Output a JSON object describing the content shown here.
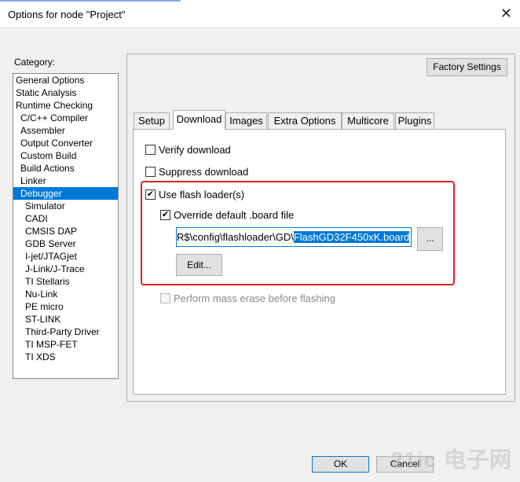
{
  "window": {
    "title": "Options for node \"Project\"",
    "close": "✕"
  },
  "category": {
    "label": "Category:",
    "items": [
      {
        "label": "General Options",
        "level": 0
      },
      {
        "label": "Static Analysis",
        "level": 0
      },
      {
        "label": "Runtime Checking",
        "level": 0
      },
      {
        "label": "C/C++ Compiler",
        "level": 1
      },
      {
        "label": "Assembler",
        "level": 1
      },
      {
        "label": "Output Converter",
        "level": 1
      },
      {
        "label": "Custom Build",
        "level": 1
      },
      {
        "label": "Build Actions",
        "level": 1
      },
      {
        "label": "Linker",
        "level": 1
      },
      {
        "label": "Debugger",
        "level": 1,
        "selected": true
      },
      {
        "label": "Simulator",
        "level": 2
      },
      {
        "label": "CADI",
        "level": 2
      },
      {
        "label": "CMSIS DAP",
        "level": 2
      },
      {
        "label": "GDB Server",
        "level": 2
      },
      {
        "label": "I-jet/JTAGjet",
        "level": 2
      },
      {
        "label": "J-Link/J-Trace",
        "level": 2
      },
      {
        "label": "TI Stellaris",
        "level": 2
      },
      {
        "label": "Nu-Link",
        "level": 2
      },
      {
        "label": "PE micro",
        "level": 2
      },
      {
        "label": "ST-LINK",
        "level": 2
      },
      {
        "label": "Third-Party Driver",
        "level": 2
      },
      {
        "label": "TI MSP-FET",
        "level": 2
      },
      {
        "label": "TI XDS",
        "level": 2
      }
    ]
  },
  "factory_settings": "Factory Settings",
  "tabs": [
    {
      "label": "Setup"
    },
    {
      "label": "Download",
      "active": true
    },
    {
      "label": "Images"
    },
    {
      "label": "Extra Options"
    },
    {
      "label": "Multicore"
    },
    {
      "label": "Plugins"
    }
  ],
  "download": {
    "verify": {
      "label": "Verify download",
      "checked": false
    },
    "suppress": {
      "label": "Suppress download",
      "checked": false
    },
    "flash_loader": {
      "label": "Use flash loader(s)",
      "checked": true
    },
    "override": {
      "label": "Override default .board file",
      "checked": true
    },
    "path_prefix": "R$\\config\\flashloader\\GD\\",
    "path_selected": "FlashGD32F450xK.board",
    "browse": "...",
    "edit": "Edit...",
    "mass_erase": {
      "label": "Perform mass erase before flashing",
      "checked": false,
      "disabled": true
    }
  },
  "footer": {
    "ok": "OK",
    "cancel": "Cancel"
  },
  "watermark": "21ic 电子网"
}
